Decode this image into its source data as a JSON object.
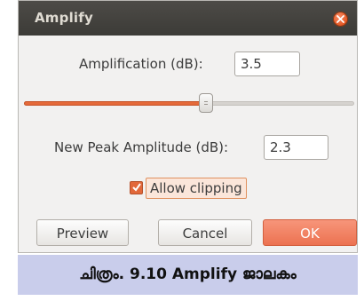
{
  "window": {
    "title": "Amplify"
  },
  "amplification": {
    "label": "Amplification (dB):",
    "value": "3.5"
  },
  "slider": {
    "level": 0.55
  },
  "new_peak": {
    "label": "New Peak Amplitude (dB):",
    "value": "2.3"
  },
  "allow_clipping": {
    "label": "Allow clipping",
    "checked": true
  },
  "buttons": {
    "preview": "Preview",
    "cancel": "Cancel",
    "ok": "OK"
  },
  "caption": {
    "text": "ചിത്രം. 9.10 Amplify ജാലകം"
  },
  "colors": {
    "accent": "#e56a3a",
    "titlebar": "#3c3b37",
    "caption_bg": "#c9cdeb"
  },
  "icons": {
    "close": "close-icon",
    "check": "check-icon"
  }
}
